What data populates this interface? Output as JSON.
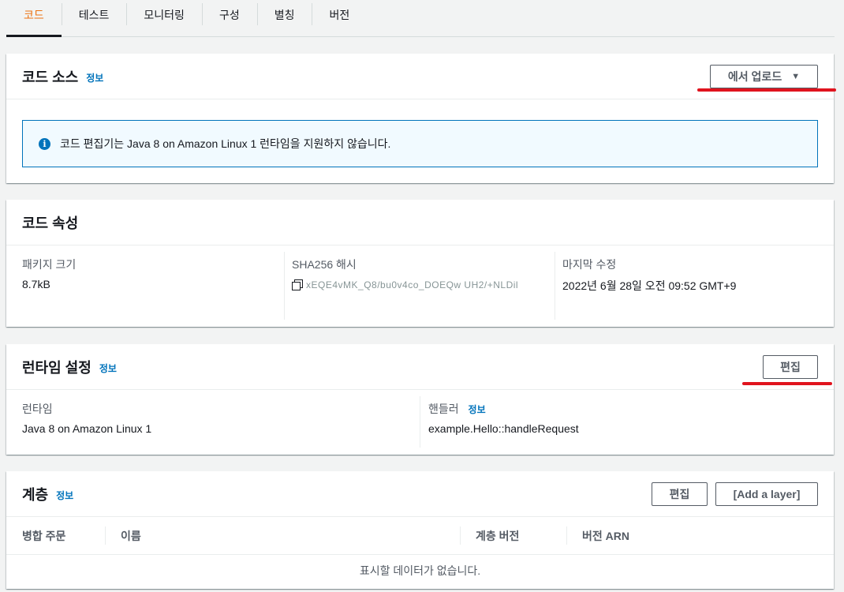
{
  "tabs": [
    {
      "label": "코드",
      "active": true
    },
    {
      "label": "테스트",
      "active": false
    },
    {
      "label": "모니터링",
      "active": false
    },
    {
      "label": "구성",
      "active": false
    },
    {
      "label": "별칭",
      "active": false
    },
    {
      "label": "버전",
      "active": false
    }
  ],
  "code_source": {
    "title": "코드 소스",
    "info": "정보",
    "upload_button": "에서 업로드",
    "alert_text": "코드 편집기는 Java 8 on Amazon Linux 1 런타임을 지원하지 않습니다."
  },
  "code_properties": {
    "title": "코드 속성",
    "package_size_label": "패키지 크기",
    "package_size_value": "8.7kB",
    "sha_label": "SHA256 해시",
    "sha_value": "xEQE4vMK_Q8/bu0v4co_DOEQw UH2/+NLDil",
    "modified_label": "마지막 수정",
    "modified_value": "2022년 6월 28일 오전 09:52 GMT+9"
  },
  "runtime_settings": {
    "title": "런타임 설정",
    "info": "정보",
    "edit_button": "편집",
    "runtime_label": "런타임",
    "runtime_value": "Java 8 on Amazon Linux 1",
    "handler_label": "핸들러",
    "handler_info": "정보",
    "handler_value": "example.Hello::handleRequest"
  },
  "layers": {
    "title": "계층",
    "info": "정보",
    "edit_button": "편집",
    "add_button": "[Add a layer]",
    "columns": [
      "병합 주문",
      "이름",
      "계층 버전",
      "버전 ARN"
    ],
    "empty_text": "표시할 데이터가 없습니다."
  },
  "colors": {
    "accent": "#ec7211",
    "link": "#0073bb",
    "highlight": "#e0141e"
  }
}
